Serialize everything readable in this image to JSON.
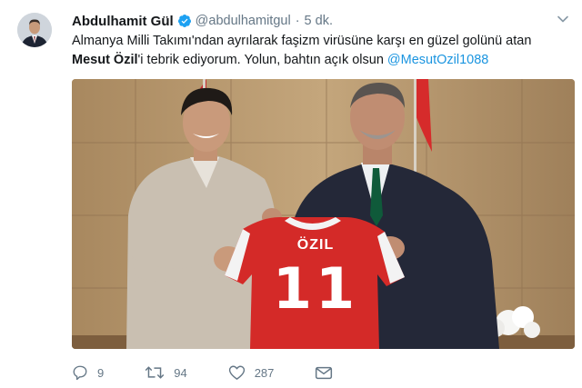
{
  "tweet": {
    "author_name": "Abdulhamit Gül",
    "handle": "@abdulhamitgul",
    "separator": "·",
    "time": "5 dk.",
    "text_line1": "Almanya Milli Takımı'ndan ayrılarak faşizm virüsüne karşı en güzel golünü atan",
    "text_bold": "Mesut Özil",
    "text_rest": "'i tebrik ediyorum. Yolun, bahtın açık olsun ",
    "mention": "@MesutOzil1088",
    "photo": {
      "jersey_name": "ÖZIL",
      "jersey_number": "11"
    },
    "actions": {
      "reply_count": "9",
      "retweet_count": "94",
      "like_count": "287"
    },
    "colors": {
      "link": "#1b95e0",
      "secondary": "#657786",
      "verified": "#1da1f2"
    },
    "icons": [
      "caret-down-icon",
      "verified-badge-icon",
      "reply-icon",
      "retweet-icon",
      "like-icon",
      "direct-message-icon"
    ]
  }
}
